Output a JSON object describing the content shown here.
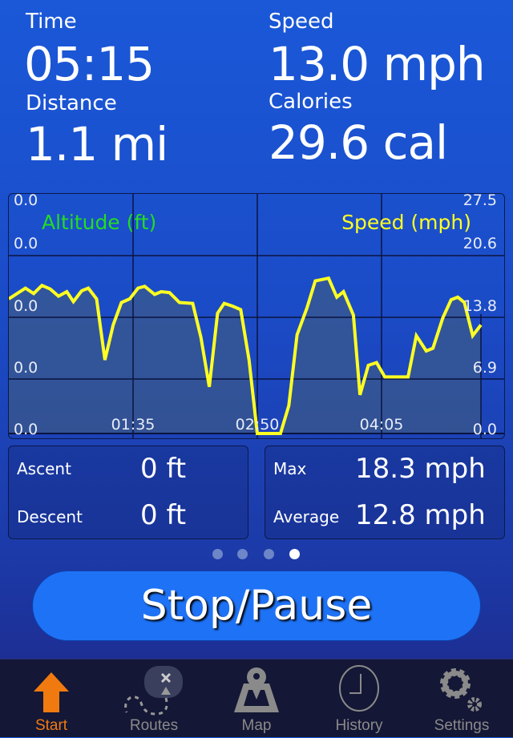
{
  "stats": {
    "time": {
      "label": "Time",
      "value": "05:15"
    },
    "speed": {
      "label": "Speed",
      "value": "13.0 mph"
    },
    "distance": {
      "label": "Distance",
      "value": "1.1 mi"
    },
    "calories": {
      "label": "Calories",
      "value": "29.6 cal"
    }
  },
  "chart_data": {
    "type": "area",
    "left_axis_label": "Altitude (ft)",
    "right_axis_label": "Speed (mph)",
    "left_ticks": [
      "0.0",
      "0.0",
      "0.0",
      "0.0",
      "0.0"
    ],
    "right_ticks": [
      "27.5",
      "20.6",
      "13.8",
      "6.9",
      "0.0"
    ],
    "x_ticks": [
      "01:35",
      "02:50",
      "04:05"
    ],
    "ylim": [
      0,
      27.5
    ],
    "grid": true,
    "colors": {
      "altitude": "#22dd22",
      "speed": "#ffff22"
    },
    "series": [
      {
        "name": "Speed (mph)",
        "t": [
          "00:20",
          "00:30",
          "00:35",
          "00:40",
          "00:45",
          "00:50",
          "00:55",
          "00:59",
          "01:04",
          "01:08",
          "01:13",
          "01:18",
          "01:23",
          "01:28",
          "01:33",
          "01:38",
          "01:42",
          "01:48",
          "01:52",
          "01:57",
          "02:03",
          "02:11",
          "02:16",
          "02:21",
          "02:26",
          "02:30",
          "02:35",
          "02:40",
          "02:45",
          "02:50",
          "03:04",
          "03:09",
          "03:14",
          "03:20",
          "03:25",
          "03:33",
          "03:38",
          "03:42",
          "03:48",
          "03:52",
          "03:57",
          "04:02",
          "04:07",
          "04:21",
          "04:26",
          "04:32",
          "04:36",
          "04:42",
          "04:47",
          "04:51",
          "04:55",
          "05:00",
          "05:05"
        ],
        "values": [
          15.0,
          16.2,
          15.6,
          16.5,
          16.1,
          15.3,
          15.8,
          14.7,
          15.9,
          16.2,
          15.0,
          8.2,
          12.1,
          14.6,
          15.0,
          16.2,
          16.4,
          15.5,
          15.8,
          15.7,
          14.6,
          14.5,
          10.7,
          5.2,
          13.4,
          14.5,
          14.2,
          13.8,
          8.2,
          0,
          0,
          3.1,
          11.0,
          14.0,
          17.0,
          17.3,
          15.2,
          15.8,
          13.2,
          4.3,
          7.6,
          7.9,
          6.3,
          6.3,
          10.9,
          9.2,
          9.5,
          12.9,
          14.9,
          15.2,
          14.6,
          10.9,
          12.1
        ]
      }
    ]
  },
  "summary": {
    "ascent": {
      "label": "Ascent",
      "value": "0 ft"
    },
    "descent": {
      "label": "Descent",
      "value": "0 ft"
    },
    "max": {
      "label": "Max",
      "value": "18.3 mph"
    },
    "average": {
      "label": "Average",
      "value": "12.8 mph"
    }
  },
  "pager": {
    "count": 4,
    "active": 4
  },
  "stop_button": "Stop/Pause",
  "tabs": [
    {
      "label": "Start",
      "icon": "arrow-up-icon",
      "active": true
    },
    {
      "label": "Routes",
      "icon": "routes-icon"
    },
    {
      "label": "Map",
      "icon": "map-pin-icon"
    },
    {
      "label": "History",
      "icon": "clock-icon"
    },
    {
      "label": "Settings",
      "icon": "gear-icon"
    }
  ],
  "colors": {
    "active_tab": "#f07a10",
    "inactive_tab": "#8a8a8a",
    "button": "#1e72f6"
  }
}
